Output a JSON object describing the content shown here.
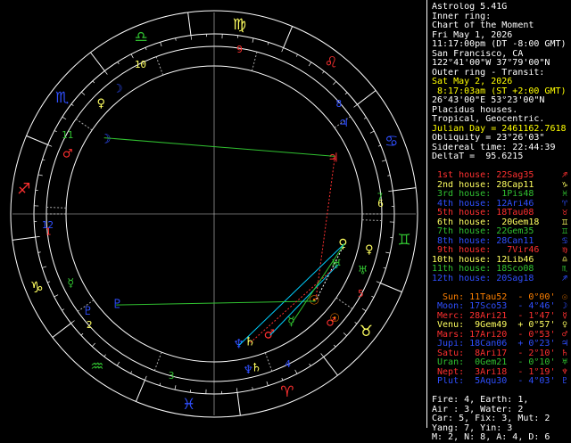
{
  "info": {
    "lines": [
      {
        "text": "Astrolog 5.41G",
        "color": "#ffffff"
      },
      {
        "text": "Inner ring:",
        "color": "#ffffff"
      },
      {
        "text": "Chart of the Moment",
        "color": "#ffffff"
      },
      {
        "text": "Fri May 1, 2026",
        "color": "#ffffff"
      },
      {
        "text": "11:17:00pm (DT -8:00 GMT)",
        "color": "#ffffff"
      },
      {
        "text": "San Francisco, CA",
        "color": "#ffffff"
      },
      {
        "text": "122°41'00\"W 37°79'00\"N",
        "color": "#ffffff"
      },
      {
        "text": "Outer ring - Transit:",
        "color": "#ffffff"
      },
      {
        "text": "Sat May 2, 2026",
        "color": "#ffff00"
      },
      {
        "text": " 8:17:03am (ST +2:00 GMT)",
        "color": "#ffff00"
      },
      {
        "text": "26°43'00\"E 53°23'00\"N",
        "color": "#ffffff"
      },
      {
        "text": "Placidus houses.",
        "color": "#ffffff"
      },
      {
        "text": "Tropical, Geocentric.",
        "color": "#ffffff"
      },
      {
        "text": "Julian Day = 2461162.7618",
        "color": "#ffff00"
      },
      {
        "text": "Obliquity = 23°26'03\"",
        "color": "#ffffff"
      },
      {
        "text": "Sidereal time: 22:44:39",
        "color": "#ffffff"
      },
      {
        "text": "DeltaT =  95.6215",
        "color": "#ffffff"
      }
    ],
    "houses": [
      {
        "text": " 1st house: 22Sag35",
        "color": "#ff3030",
        "glyph": "♐"
      },
      {
        "text": " 2nd house: 28Cap11",
        "color": "#ffff60",
        "glyph": "♑"
      },
      {
        "text": " 3rd house:  1Pis48",
        "color": "#30c030",
        "glyph": "♓"
      },
      {
        "text": " 4th house: 12Ari46",
        "color": "#2f4fff",
        "glyph": "♈"
      },
      {
        "text": " 5th house: 18Tau08",
        "color": "#ff3030",
        "glyph": "♉"
      },
      {
        "text": " 6th house:  20Gem18",
        "color": "#ffff60",
        "glyph": "♊"
      },
      {
        "text": " 7th house: 22Gem35",
        "color": "#30c030",
        "glyph": "♊"
      },
      {
        "text": " 8th house: 28Can11",
        "color": "#2f4fff",
        "glyph": "♋"
      },
      {
        "text": " 9th house:   7Vir46",
        "color": "#ff3030",
        "glyph": "♍"
      },
      {
        "text": "10th house: 12Lib46",
        "color": "#ffff60",
        "glyph": "♎"
      },
      {
        "text": "11th house: 18Sco08",
        "color": "#30c030",
        "glyph": "♏"
      },
      {
        "text": "12th house: 20Sag18",
        "color": "#2f4fff",
        "glyph": "♐"
      }
    ],
    "planets": [
      {
        "text": "  Sun: 11Tau52  - 0°00'",
        "color": "#ff8000",
        "glyph": "☉"
      },
      {
        "text": " Moon: 17Sco53  - 4°46'",
        "color": "#2f4fff",
        "glyph": "☽"
      },
      {
        "text": " Merc: 28Ari21  - 1°47'",
        "color": "#ff3030",
        "glyph": "☿"
      },
      {
        "text": " Venu:  9Gem49  + 0°57'",
        "color": "#ffff60",
        "glyph": "♀"
      },
      {
        "text": " Mars: 17Ari20  - 0°53'",
        "color": "#ff3030",
        "glyph": "♂"
      },
      {
        "text": " Jupi: 18Can06  + 0°23'",
        "color": "#2f4fff",
        "glyph": "♃"
      },
      {
        "text": " Satu:  8Ari17  - 2°10'",
        "color": "#ff3030",
        "glyph": "♄"
      },
      {
        "text": " Uran:  0Gem21  - 0°10'",
        "color": "#30c030",
        "glyph": "♅"
      },
      {
        "text": " Nept:  3Ari18  - 1°19'",
        "color": "#ff3030",
        "glyph": "♆"
      },
      {
        "text": " Plut:  5Aqu30  - 4°03'",
        "color": "#2f4fff",
        "glyph": "♇"
      }
    ],
    "elements": [
      "Fire: 4, Earth: 1,",
      "Air : 3, Water: 2",
      "Car: 5, Fix: 3, Mut: 2",
      "Yang: 7, Yin: 3",
      "M: 2, N: 8, A: 4, D: 6"
    ]
  },
  "wheel": {
    "signs": [
      {
        "glyph": "♈",
        "color": "#ff3030"
      },
      {
        "glyph": "♉",
        "color": "#ffff60"
      },
      {
        "glyph": "♊",
        "color": "#30c030"
      },
      {
        "glyph": "♋",
        "color": "#2f4fff"
      },
      {
        "glyph": "♌",
        "color": "#ff3030"
      },
      {
        "glyph": "♍",
        "color": "#ffff60"
      },
      {
        "glyph": "♎",
        "color": "#30c030"
      },
      {
        "glyph": "♏",
        "color": "#2f4fff"
      },
      {
        "glyph": "♐",
        "color": "#ff3030"
      },
      {
        "glyph": "♑",
        "color": "#ffff60"
      },
      {
        "glyph": "♒",
        "color": "#30c030"
      },
      {
        "glyph": "♓",
        "color": "#2f4fff"
      }
    ],
    "house_numbers": [
      "1",
      "2",
      "3",
      "4",
      "5",
      "6",
      "7",
      "8",
      "9",
      "10",
      "11",
      "12"
    ],
    "house_colors": [
      "#ff3030",
      "#ffff60",
      "#30c030",
      "#2f4fff",
      "#ff3030",
      "#ffff60",
      "#30c030",
      "#2f4fff",
      "#ff3030",
      "#ffff60",
      "#30c030",
      "#2f4fff"
    ]
  }
}
